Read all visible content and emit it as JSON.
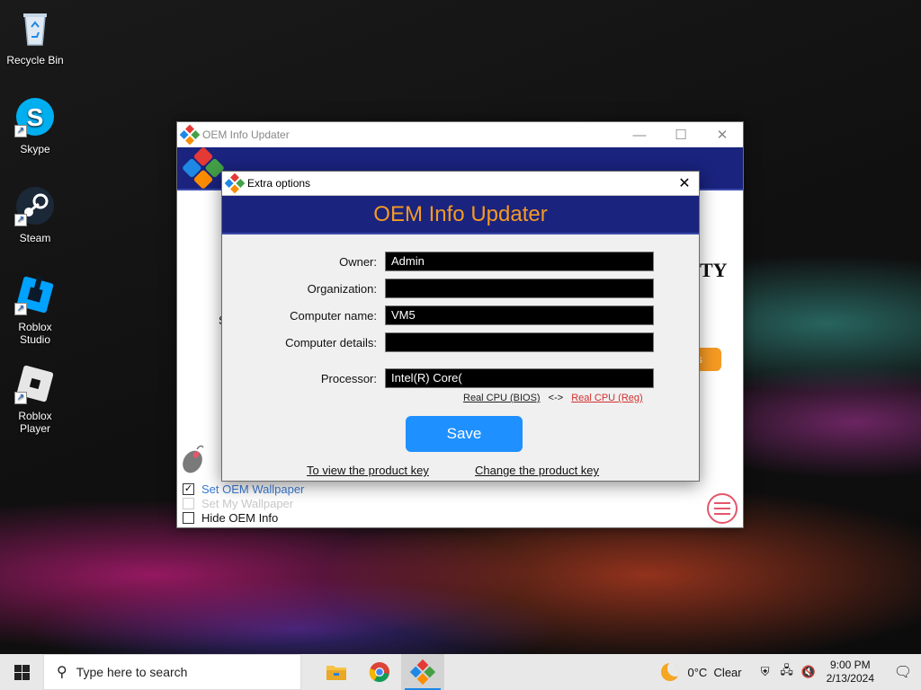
{
  "desktop": {
    "icons": [
      {
        "label": "Recycle Bin",
        "icon": "recycle-bin-icon"
      },
      {
        "label": "Skype",
        "icon": "skype-icon"
      },
      {
        "label": "Steam",
        "icon": "steam-icon"
      },
      {
        "label": "Roblox Studio",
        "icon": "roblox-studio-icon"
      },
      {
        "label": "Roblox Player",
        "icon": "roblox-player-icon"
      }
    ]
  },
  "main_window": {
    "title": "OEM Info Updater",
    "checkboxes": [
      {
        "label": "Set OEM Wallpaper",
        "checked": true
      },
      {
        "label": "Set My Wallpaper",
        "checked": false
      },
      {
        "label": "Hide OEM Info",
        "checked": false
      }
    ]
  },
  "dialog": {
    "title": "Extra options",
    "banner": "OEM Info Updater",
    "fields": {
      "owner": {
        "label": "Owner:",
        "value": "Admin"
      },
      "organization": {
        "label": "Organization:",
        "value": ""
      },
      "computer_name": {
        "label": "Computer name:",
        "value": "VM5"
      },
      "computer_details": {
        "label": "Computer details:",
        "value": ""
      },
      "processor": {
        "label": "Processor:",
        "value": "Intel(R) Core("
      }
    },
    "cpu_links": {
      "bios": "Real CPU (BIOS)",
      "sep": "<->",
      "reg": "Real CPU (Reg)"
    },
    "save_label": "Save",
    "view_key_link": "To view the product key",
    "change_key_link": "Change the product key"
  },
  "taskbar": {
    "search_placeholder": "Type here to search",
    "weather": "0°C  Clear",
    "time": "9:00 PM",
    "date": "2/13/2024"
  },
  "colors": {
    "banner": "#1a237e",
    "accent_orange": "#f59a23",
    "save_button": "#1e90ff",
    "link_red": "#d32f2f"
  }
}
